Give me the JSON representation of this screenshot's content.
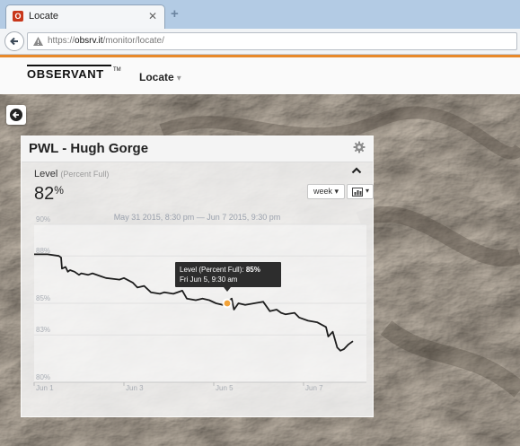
{
  "browser": {
    "tab_title": "Locate",
    "tab_favicon_letter": "O",
    "url_prefix": "https://",
    "url_host": "obsrv.it",
    "url_path": "/monitor/locate/"
  },
  "app": {
    "logo": "OBSERVANT",
    "logo_tm": "TM",
    "nav_label": "Locate",
    "accent_color": "#e8892a"
  },
  "panel": {
    "title": "PWL - Hugh Gorge",
    "metric_label": "Level",
    "metric_sub": "(Percent Full)",
    "metric_value": "82",
    "metric_unit": "%",
    "range_button": "week",
    "date_range": "May 31 2015, 8:30 pm — Jun 7 2015, 9:30 pm"
  },
  "tooltip": {
    "prefix": "Level (Percent Full): ",
    "value": "85%",
    "date": "Fri Jun 5, 9:30 am"
  },
  "chart_data": {
    "type": "line",
    "ylim": [
      80,
      90
    ],
    "yticks": [
      80,
      83,
      85,
      88,
      90
    ],
    "ytick_labels": [
      "80%",
      "83%",
      "85%",
      "88%",
      "90%"
    ],
    "xlim": [
      0,
      7.4
    ],
    "xticks": [
      0,
      2,
      4,
      6
    ],
    "xtick_labels": [
      "Jun 1",
      "Jun 3",
      "Jun 5",
      "Jun 7"
    ],
    "series": [
      {
        "color": "#1e1e1e",
        "x": [
          0,
          0.3,
          0.55,
          0.6,
          0.62,
          0.7,
          0.75,
          0.8,
          0.9,
          1.0,
          1.05,
          1.2,
          1.3,
          1.5,
          1.6,
          1.9,
          2.0,
          2.2,
          2.3,
          2.45,
          2.6,
          2.8,
          2.9,
          3.1,
          3.3,
          3.4,
          3.6,
          3.75,
          3.9,
          4.05,
          4.2,
          4.4,
          4.45,
          4.55,
          4.7,
          4.9,
          5.1,
          5.25,
          5.4,
          5.5,
          5.6,
          5.8,
          5.9,
          6.1,
          6.3,
          6.5,
          6.55,
          6.65,
          6.75,
          6.82,
          6.9,
          7.0,
          7.1
        ],
        "y": [
          88.1,
          88.1,
          88.0,
          87.9,
          87.2,
          87.3,
          87.0,
          87.1,
          87.0,
          86.8,
          86.9,
          86.8,
          86.9,
          86.7,
          86.6,
          86.5,
          86.6,
          86.3,
          86.0,
          86.1,
          85.7,
          85.6,
          85.7,
          85.6,
          85.8,
          85.3,
          85.2,
          85.3,
          85.2,
          85.0,
          84.9,
          85.3,
          84.6,
          85.0,
          84.9,
          85.0,
          85.1,
          84.5,
          84.6,
          84.4,
          84.3,
          84.4,
          84.1,
          83.9,
          83.8,
          83.5,
          82.9,
          83.2,
          82.2,
          82.0,
          82.1,
          82.4,
          82.6
        ]
      }
    ],
    "highlight": {
      "x": 4.3,
      "y": 85.0
    }
  }
}
